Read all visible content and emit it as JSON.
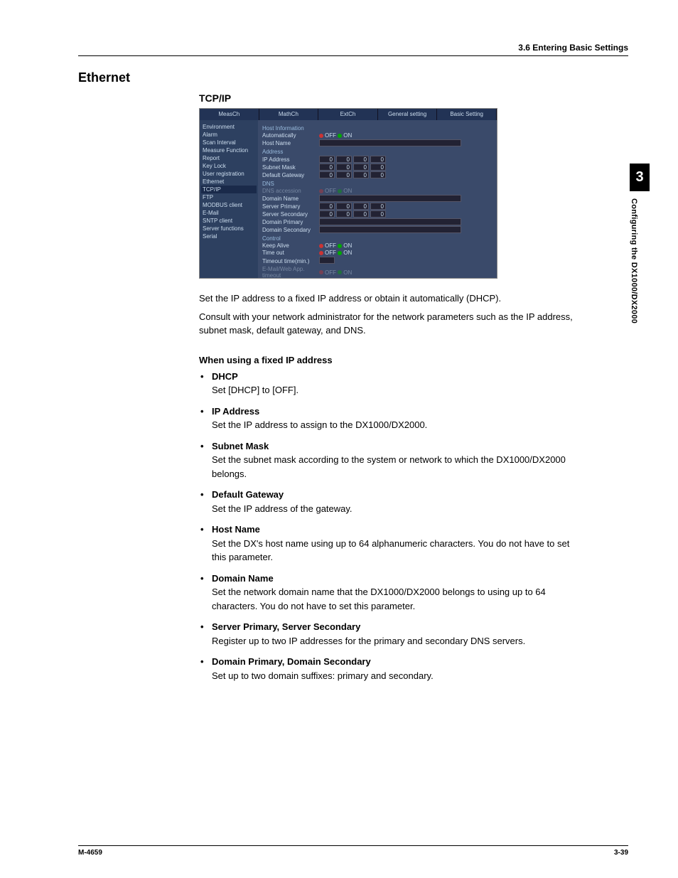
{
  "header": {
    "breadcrumb": "3.6  Entering Basic Settings"
  },
  "sidetab": {
    "num": "3",
    "text": "Configuring the DX1000/DX2000"
  },
  "section_title": "Ethernet",
  "subsection_title": "TCP/IP",
  "screenshot": {
    "tabs": [
      "MeasCh",
      "MathCh",
      "ExtCh",
      "General setting",
      "Basic Setting"
    ],
    "sidebar": [
      "Environment",
      "Alarm",
      "Scan Interval",
      "Measure Function",
      "Report",
      "Key Lock",
      "User registration",
      "Ethernet",
      "TCP/IP",
      "FTP",
      "MODBUS client",
      "E-Mail",
      "SNTP client",
      "Server functions",
      "Serial"
    ],
    "sidebar_selected": 8,
    "groups": {
      "host_info": "Host Information",
      "automatically": "Automatically",
      "host_name": "Host Name",
      "address": "Address",
      "ip_address": "IP Address",
      "subnet_mask": "Subnet Mask",
      "default_gateway": "Default Gateway",
      "dns": "DNS",
      "dns_accession": "DNS accession",
      "domain_name": "Domain Name",
      "server_primary": "Server Primary",
      "server_secondary": "Server Secondary",
      "domain_primary": "Domain Primary",
      "domain_secondary": "Domain Secondary",
      "control": "Control",
      "keep_alive": "Keep Alive",
      "time_out": "Time out",
      "timeout_time": "Timeout time(min.)",
      "app_timeout": "E-Mail/Web App. timeout"
    },
    "off": "OFF",
    "on": "ON",
    "ip_zero": "0"
  },
  "intro": {
    "p1": "Set the IP address to a fixed IP address or obtain it automatically (DHCP).",
    "p2": "Consult with your network administrator for the network parameters such as the IP address, subnet mask, default gateway, and DNS."
  },
  "when_heading": "When using a fixed IP address",
  "items": [
    {
      "term": "DHCP",
      "desc": "Set [DHCP] to [OFF]."
    },
    {
      "term": "IP Address",
      "desc": "Set the IP address to assign to the DX1000/DX2000."
    },
    {
      "term": "Subnet Mask",
      "desc": "Set the subnet mask according to the system or network to which the DX1000/DX2000 belongs."
    },
    {
      "term": "Default Gateway",
      "desc": "Set the IP address of the gateway."
    },
    {
      "term": "Host Name",
      "desc": "Set the DX's host name using up to 64 alphanumeric characters.  You do not have to set this parameter."
    },
    {
      "term": "Domain Name",
      "desc": "Set the network domain name that the DX1000/DX2000 belongs to using up to 64 characters.  You do not have to set this parameter."
    },
    {
      "term": "Server Primary, Server Secondary",
      "desc": "Register up to two IP addresses for the primary and secondary DNS servers."
    },
    {
      "term": "Domain Primary, Domain Secondary",
      "desc": "Set up to two domain suffixes: primary and secondary."
    }
  ],
  "footer": {
    "left": "M-4659",
    "right": "3-39"
  }
}
